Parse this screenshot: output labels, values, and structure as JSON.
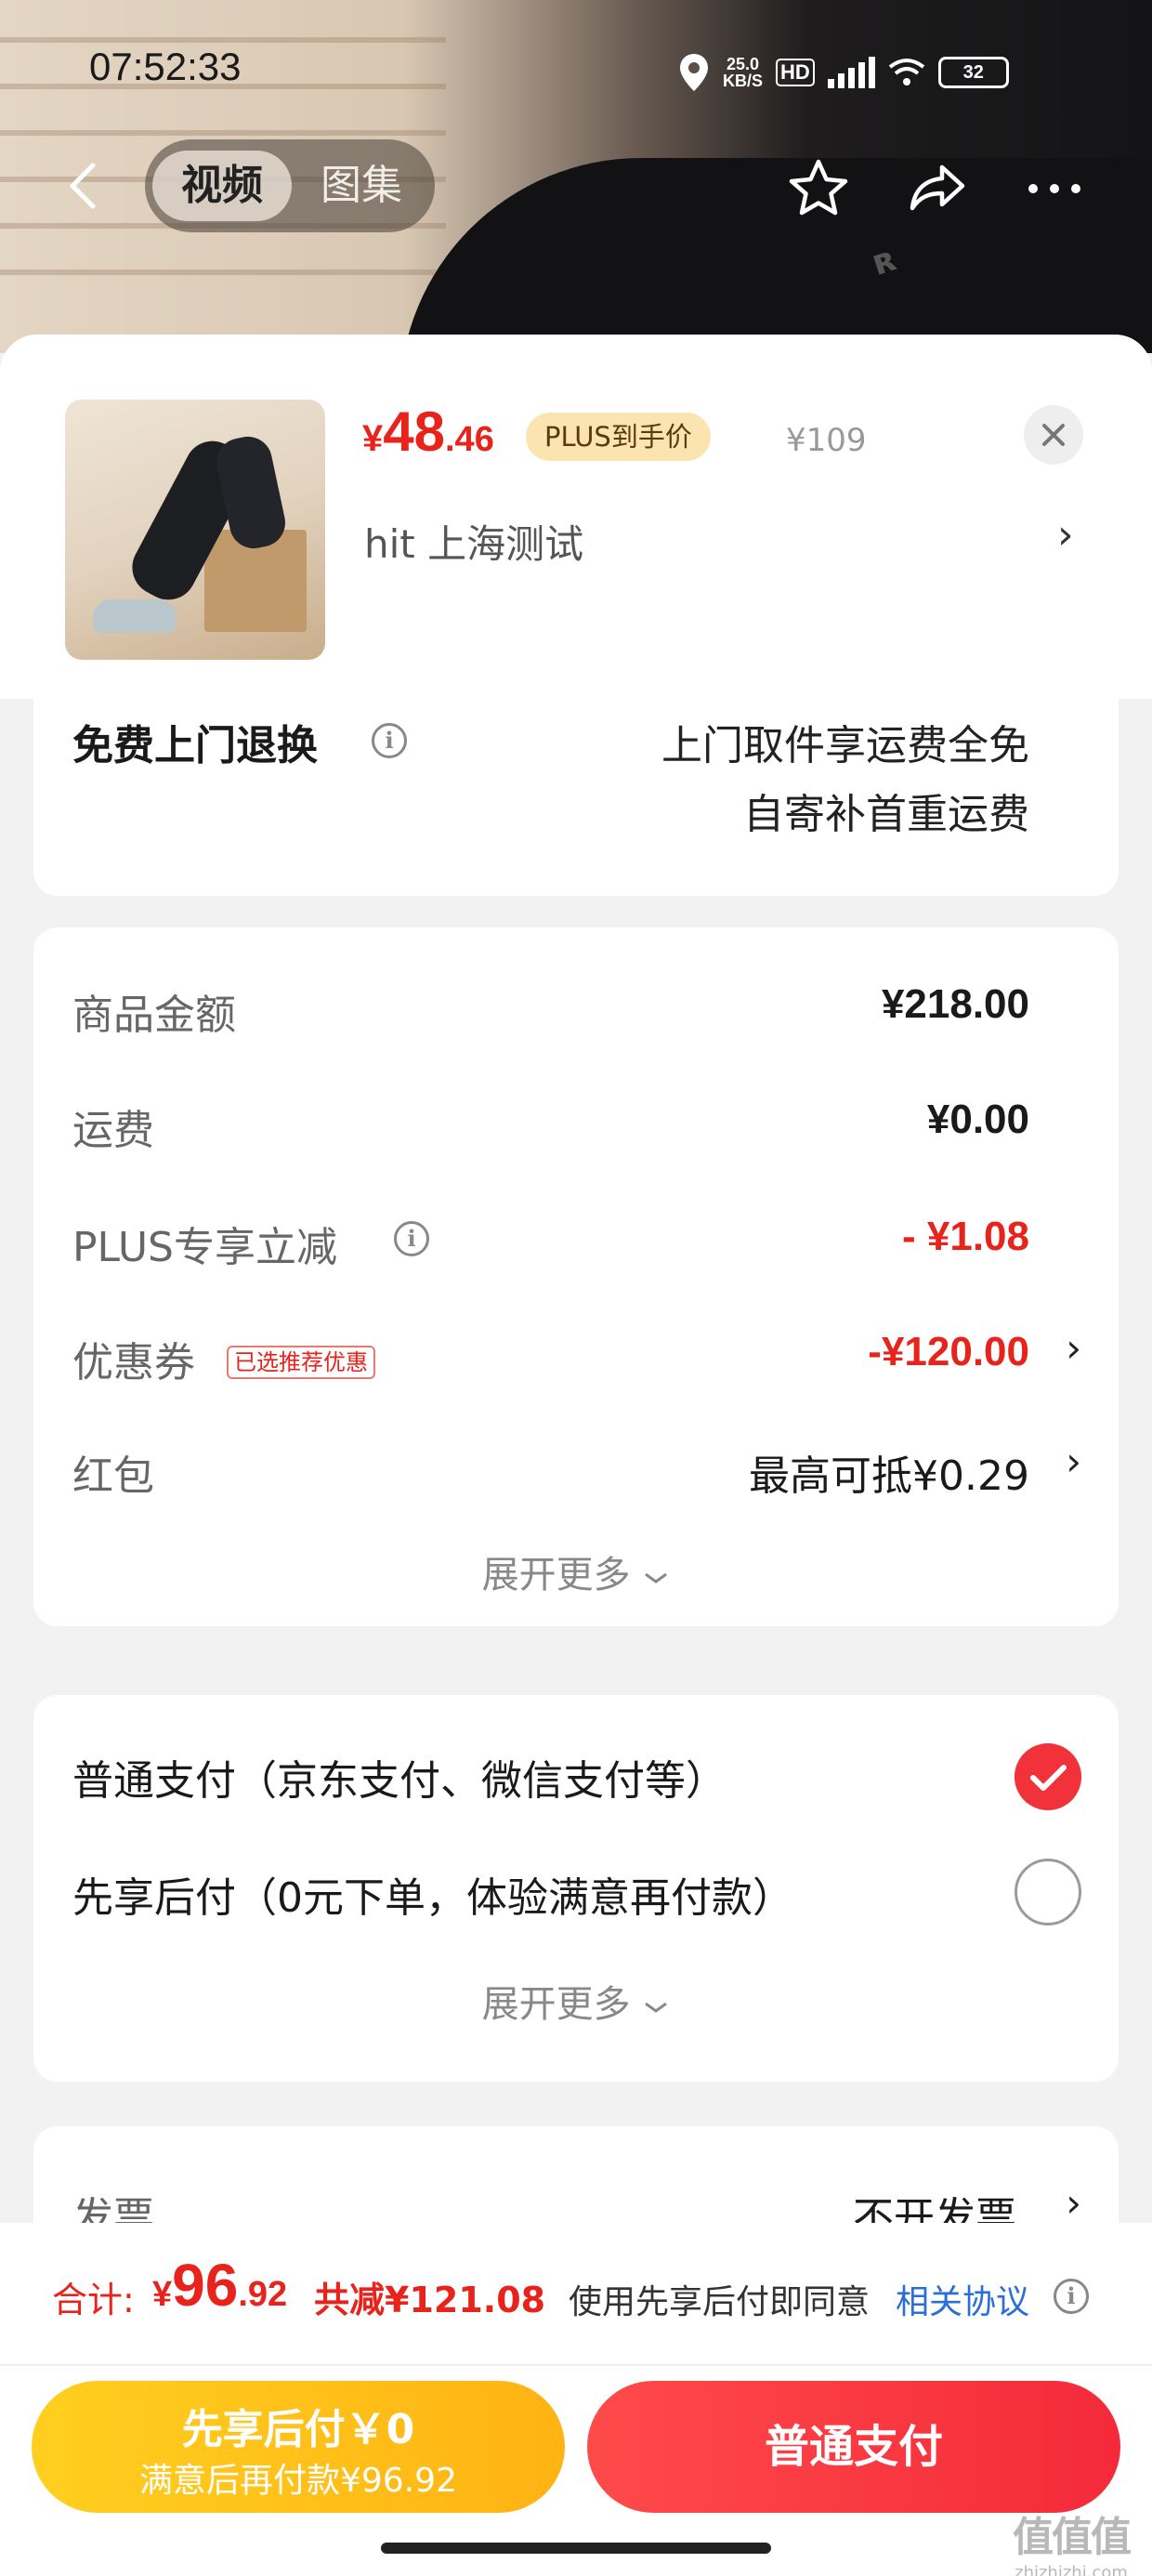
{
  "status": {
    "time": "07:52:33",
    "net_speed_value": "25.0",
    "net_speed_unit": "KB/S",
    "hd": "HD",
    "battery": "32"
  },
  "nav": {
    "tab_video": "视频",
    "tab_gallery": "图集"
  },
  "product": {
    "price_currency": "¥",
    "price_int": "48",
    "price_dec": ".46",
    "plus_tag": "PLUS到手价",
    "original_price": "¥109",
    "variant": "hit  上海测试",
    "arrow": "›"
  },
  "return_service": {
    "title": "免费上门退换",
    "line1": "上门取件享运费全免",
    "line2": "自寄补首重运费"
  },
  "cost": {
    "goods_label": "商品金额",
    "goods_value": "¥218.00",
    "shipping_label": "运费",
    "shipping_value": "¥0.00",
    "plus_label": "PLUS专享立减",
    "plus_value": "- ¥1.08",
    "coupon_label": "优惠券",
    "coupon_tag": "已选推荐优惠",
    "coupon_value": "-¥120.00",
    "redpacket_label": "红包",
    "redpacket_value": "最高可抵¥0.29",
    "expand": "展开更多",
    "arrow": "›"
  },
  "payment": {
    "option_normal": "普通支付（京东支付、微信支付等）",
    "option_later": "先享后付（0元下单，体验满意再付款）",
    "expand": "展开更多",
    "selected": "normal"
  },
  "invoice": {
    "label": "发票",
    "value": "不开发票",
    "arrow": "›"
  },
  "summary": {
    "total_label": "合计:",
    "total_currency": "¥",
    "total_int": "96",
    "total_dec": ".92",
    "discount": "共减¥121.08",
    "agree_text": "使用先享后付即同意",
    "agree_link": "相关协议"
  },
  "buttons": {
    "later_line1": "先享后付￥0",
    "later_line2": "满意后再付款¥96.92",
    "normal": "普通支付"
  },
  "watermark": {
    "text": "值值值",
    "sub": "zhizhizhi.com"
  },
  "colors": {
    "price_red": "#e8231c",
    "link_blue": "#2a6ed6",
    "plus_gold": "#fbe4b0",
    "later_yellow": "#ffb314",
    "pay_red": "#f42a3a"
  }
}
